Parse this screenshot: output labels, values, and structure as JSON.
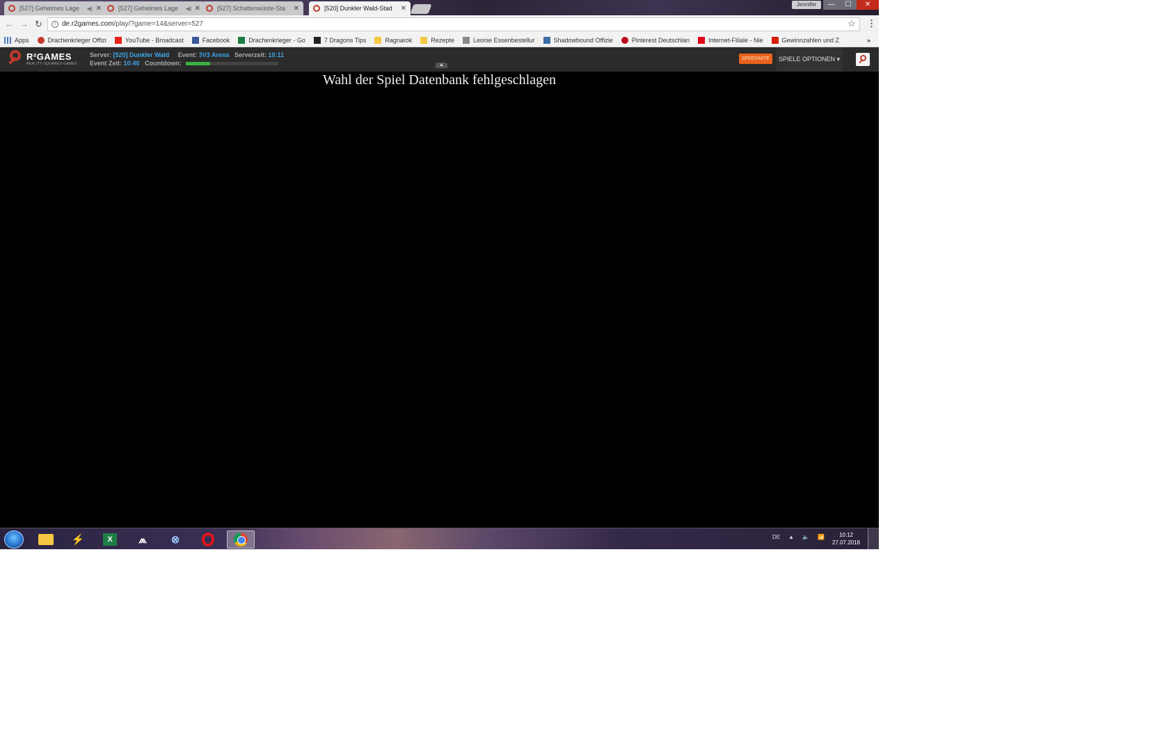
{
  "browser": {
    "tabs": [
      {
        "title": "[527] Geheimes Lage",
        "audio": true
      },
      {
        "title": "[527] Geheimes Lage",
        "audio": true
      },
      {
        "title": "[527] Schattenwüste-Sta",
        "audio": false
      },
      {
        "title": "[520] Dunkler Wald-Stad",
        "audio": false,
        "active": true
      }
    ],
    "user_name": "Jennifer",
    "window_buttons": {
      "minimize": "—",
      "maximize": "☐",
      "close": "✕"
    },
    "url_host": "de.r2games.com",
    "url_path": "/play/?game=14&server=527",
    "bookmarks": [
      {
        "label": "Apps",
        "icon": "apps-grid",
        "color": "#4a78c2"
      },
      {
        "label": "Drachenkrieger Offizi",
        "icon": "r2-logo",
        "color": "#c0392b"
      },
      {
        "label": "YouTube - Broadcast",
        "icon": "youtube",
        "color": "#e62117"
      },
      {
        "label": "Facebook",
        "icon": "facebook",
        "color": "#3b5998"
      },
      {
        "label": "Drachenkrieger - Go",
        "icon": "sheet",
        "color": "#1e7d45"
      },
      {
        "label": "7 Dragons Tips",
        "icon": "dragon",
        "color": "#222222"
      },
      {
        "label": "Ragnarok",
        "icon": "folder",
        "color": "#f5c842"
      },
      {
        "label": "Rezepte",
        "icon": "folder",
        "color": "#f5c842"
      },
      {
        "label": "Leonie Essenbestellur",
        "icon": "page",
        "color": "#888888"
      },
      {
        "label": "Shadowbound Offizie",
        "icon": "shadowbound",
        "color": "#3a6ea5"
      },
      {
        "label": "Pinterest Deutschlan",
        "icon": "pinterest",
        "color": "#bd081c"
      },
      {
        "label": "Internet-Filiale - Nie",
        "icon": "sparkasse",
        "color": "#e3001b"
      },
      {
        "label": "Gewinnzahlen und Z",
        "icon": "lotto",
        "color": "#d81e05"
      }
    ],
    "bookmarks_more": "»"
  },
  "game_header": {
    "logo_title": "R²GAMES",
    "logo_subtitle": "REALITY SQUARED GAMES",
    "server_label": "Server:",
    "server_value": "[520] Dunkler Wald",
    "event_label": "Event:",
    "event_value": "3V3 Arena",
    "server_time_label": "Serverzeit:",
    "server_time_value": "10:11",
    "event_time_label": "Event Zeit:",
    "event_time_value": "10:40",
    "countdown_label": "Countdown:",
    "countdown_progress": 0.26,
    "speed_button": "SPEEDMITE",
    "options_button": "SPIELE OPTIONEN ▾",
    "collapse_arrow": "▲"
  },
  "game": {
    "error_message": "Wahl der Spiel Datenbank fehlgeschlagen"
  },
  "taskbar": {
    "apps": [
      "start",
      "explorer",
      "winrar",
      "excel",
      "arc",
      "network",
      "opera",
      "chrome"
    ],
    "tray_lang": "DE",
    "tray_icons": [
      "▲",
      "🔈",
      "📶"
    ],
    "clock_time": "10:12",
    "clock_date": "27.07.2018"
  }
}
